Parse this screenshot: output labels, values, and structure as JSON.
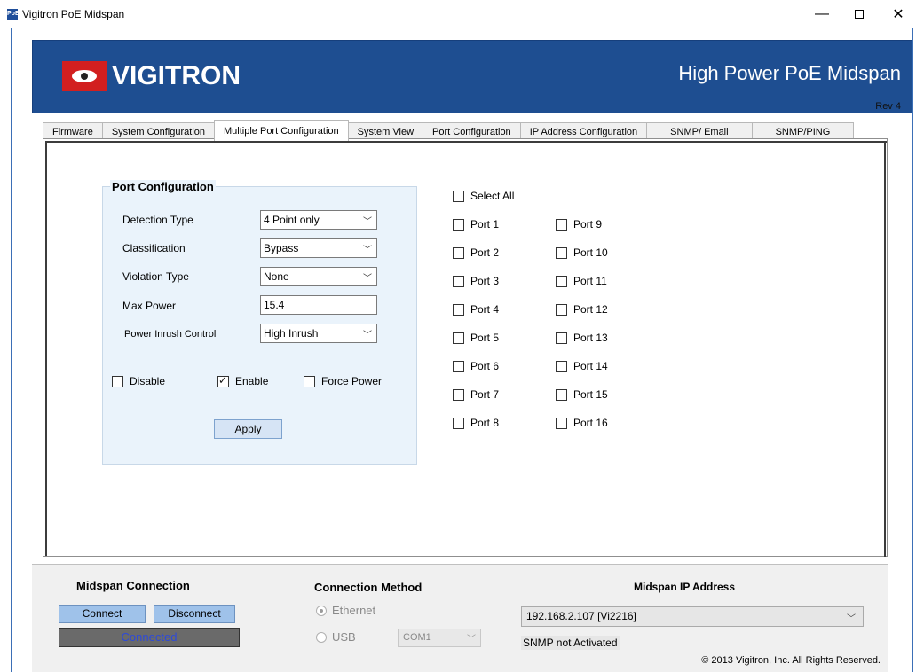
{
  "window": {
    "app_icon_text": "PoE",
    "title": "Vigitron PoE Midspan",
    "minimize": "—",
    "close": "✕"
  },
  "banner": {
    "logo_text": "VIGITRON",
    "title": "High Power PoE Midspan",
    "rev": "Rev 4",
    "background_color": "#1e4e91"
  },
  "tabs": [
    {
      "label": "Firmware"
    },
    {
      "label": "System Configuration"
    },
    {
      "label": "Multiple Port Configuration"
    },
    {
      "label": "System View"
    },
    {
      "label": "Port Configuration"
    },
    {
      "label": "IP Address Configuration"
    },
    {
      "label": "SNMP/ Email"
    },
    {
      "label": "SNMP/PING"
    }
  ],
  "active_tab": "Multiple Port Configuration",
  "port_configuration": {
    "title": "Port Configuration",
    "detection_type": {
      "label": "Detection Type",
      "value": "4 Point only"
    },
    "classification": {
      "label": "Classification",
      "value": "Bypass"
    },
    "violation_type": {
      "label": "Violation Type",
      "value": "None"
    },
    "max_power": {
      "label": "Max Power",
      "value": "15.4"
    },
    "power_inrush": {
      "label": "Power Inrush Control",
      "value": "High Inrush"
    },
    "disable": {
      "label": "Disable",
      "checked": false
    },
    "enable": {
      "label": "Enable",
      "checked": true
    },
    "force_power": {
      "label": "Force Power",
      "checked": false
    },
    "apply_label": "Apply"
  },
  "ports": {
    "select_all": "Select All",
    "list": [
      "Port 1",
      "Port 2",
      "Port 3",
      "Port 4",
      "Port 5",
      "Port 6",
      "Port 7",
      "Port 8",
      "Port 9",
      "Port 10",
      "Port 11",
      "Port 12",
      "Port 13",
      "Port 14",
      "Port 15",
      "Port 16"
    ]
  },
  "bottom": {
    "midspan_connection": "Midspan Connection",
    "connect": "Connect",
    "disconnect": "Disconnect",
    "status": "Connected",
    "connection_method": "Connection Method",
    "ethernet": "Ethernet",
    "usb": "USB",
    "com_port": "COM1",
    "midspan_ip_address": "Midspan IP Address",
    "ip_value": "192.168.2.107 [Vi2216]",
    "snmp_status": "SNMP not Activated",
    "copyright": "© 2013 Vigitron, Inc. All Rights Reserved."
  }
}
